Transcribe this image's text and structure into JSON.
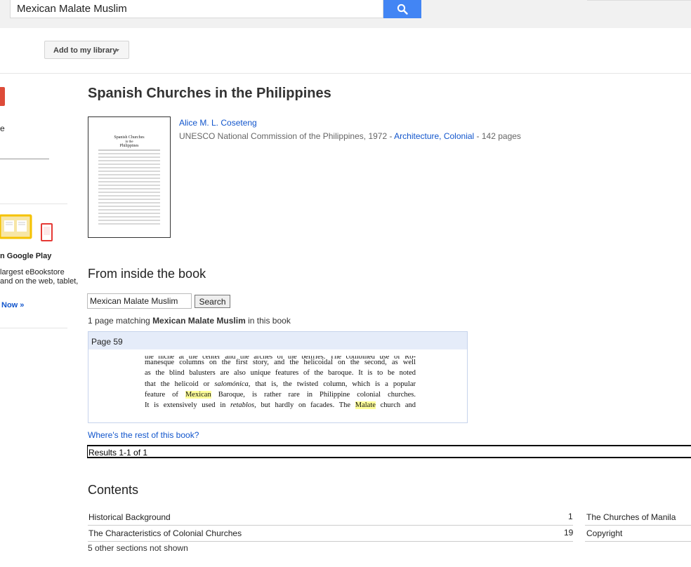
{
  "search": {
    "query": "Mexican Malate Muslim",
    "icon": "search-icon"
  },
  "toolbar": {
    "add_to_library": "Add to my library"
  },
  "sidebar": {
    "fragment_e": "e",
    "play_title": "n Google Play",
    "play_text": "largest eBookstore and on the web, tablet,",
    "play_cta": "Now »"
  },
  "book": {
    "title": "Spanish Churches in the Philippines",
    "author": "Alice M. L. Coseteng",
    "publisher_year": "UNESCO National Commission of the Philippines, 1972 - ",
    "subject": "Architecture, Colonial",
    "pages": " - 142 pages"
  },
  "inside": {
    "heading": "From inside the book",
    "search_value": "Mexican Malate Muslim",
    "search_button": "Search",
    "match_prefix": "1 page matching ",
    "match_query": "Mexican Malate Muslim",
    "match_suffix": " in this book",
    "result_page": "Page 59",
    "rest_link": "Where's the rest of this book?",
    "results": "Results 1-1 of 1"
  },
  "snippet": {
    "line0": "the niche at the center and the arches of the belfries. The combined use of Ro-",
    "line1": "manesque columns on the first story, and the helicoidal on the second, as well",
    "line2": "as the blind balusters are also unique features of the baroque. It is to be noted",
    "line3a": "that the helicoid or ",
    "line3b": "salomónica,",
    "line3c": " that is, the twisted column, which is a popular",
    "line4a": "feature of ",
    "line4hl": "Mexican",
    "line4b": " Baroque, is rather rare in Philippine colonial churches.",
    "line5a": "It is extensively used in ",
    "line5b": "retablos,",
    "line5c": " but hardly on facades. The ",
    "line5hl": "Malate",
    "line5d": " church and"
  },
  "contents": {
    "heading": "Contents",
    "left": [
      {
        "title": "Historical Background",
        "page": "1"
      },
      {
        "title": "The Characteristics of Colonial Churches",
        "page": "19"
      }
    ],
    "right": [
      {
        "title": "The Churches of Manila"
      },
      {
        "title": "Copyright"
      }
    ],
    "other": "5 other sections not shown"
  },
  "colors": {
    "link": "#1155cc",
    "search_button": "#4285f4",
    "highlight": "#ffff99",
    "snippet_header": "#e5ecf9"
  }
}
